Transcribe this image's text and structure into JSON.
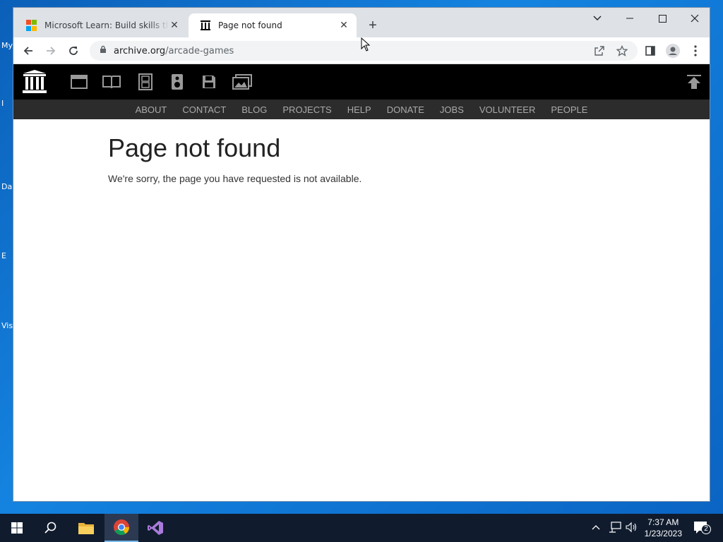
{
  "desktop": {
    "icons": [
      "My",
      "I",
      "Da",
      "E",
      "Vis"
    ]
  },
  "browser": {
    "tabs": [
      {
        "title": "Microsoft Learn: Build skills that open doors in your career",
        "active": false
      },
      {
        "title": "Page not found",
        "active": true
      }
    ],
    "new_tab": "+",
    "url_domain": "archive.org",
    "url_path": "/arcade-games"
  },
  "page": {
    "nav": [
      "ABOUT",
      "CONTACT",
      "BLOG",
      "PROJECTS",
      "HELP",
      "DONATE",
      "JOBS",
      "VOLUNTEER",
      "PEOPLE"
    ],
    "heading": "Page not found",
    "message": "We're sorry, the page you have requested is not available."
  },
  "taskbar": {
    "time": "7:37 AM",
    "date": "1/23/2023",
    "notification_count": "2"
  },
  "colors": {
    "ms_red": "#f25022",
    "ms_green": "#7fba00",
    "ms_blue": "#00a4ef",
    "ms_yellow": "#ffb900"
  }
}
